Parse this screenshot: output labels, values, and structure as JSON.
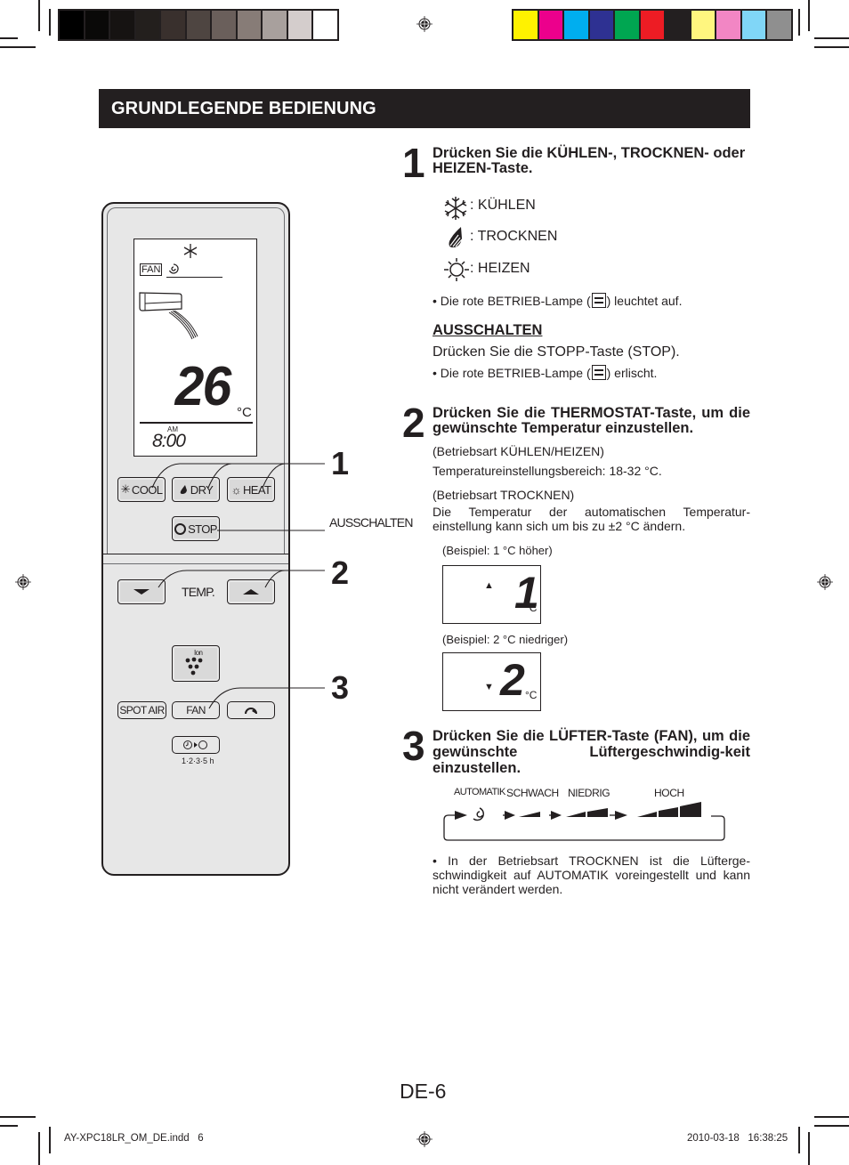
{
  "print_marks": {
    "gray_swatches": [
      "#000000",
      "#0a0908",
      "#161312",
      "#231f1d",
      "#39302d",
      "#4e4541",
      "#6a5f5b",
      "#877c77",
      "#a8a09d",
      "#d4cdcc",
      "#ffffff"
    ],
    "color_swatches": [
      "#fff200",
      "#ec008c",
      "#00aeef",
      "#2e3192",
      "#00a651",
      "#ed1c24",
      "#231f20",
      "#fff67f",
      "#f286c4",
      "#80d6f7",
      "#8f8f8f"
    ]
  },
  "header": {
    "title": "GRUNDLEGENDE BEDIENUNG"
  },
  "step1": {
    "number": "1",
    "title": "Drücken Sie die KÜHLEN-, TROCKNEN- oder HEIZEN-Taste.",
    "modes": [
      {
        "icon": "snowflake-icon",
        "label": ": KÜHLEN"
      },
      {
        "icon": "droplet-icon",
        "label": ": TROCKNEN"
      },
      {
        "icon": "sun-icon",
        "label": ": HEIZEN"
      }
    ],
    "note_before": "• Die rote BETRIEB-Lampe (",
    "note_after": ") leuchtet auf."
  },
  "off": {
    "heading": "AUSSCHALTEN",
    "text": "Drücken Sie die STOPP-Taste (STOP).",
    "note_before": "• Die rote BETRIEB-Lampe (",
    "note_after": ") erlischt."
  },
  "step2": {
    "number": "2",
    "title": "Drücken Sie die THERMOSTAT-Taste, um die gewünschte Temperatur einzustellen.",
    "mode1": "(Betriebsart KÜHLEN/HEIZEN)",
    "range": "Temperatureinstellungsbereich: 18-32 °C.",
    "mode2": "(Betriebsart TROCKNEN)",
    "dry_text": "Die Temperatur der automatischen Temperatur-einstellung kann sich um bis zu ±2 °C ändern.",
    "example1": {
      "caption": "(Beispiel: 1 °C höher)",
      "arrow": "▲",
      "digit": "1",
      "unit": "°C"
    },
    "example2": {
      "caption": "(Beispiel: 2 °C niedriger)",
      "arrow": "▼",
      "digit": "2",
      "unit": "°C"
    }
  },
  "step3": {
    "number": "3",
    "title": "Drücken Sie die LÜFTER-Taste (FAN), um die gewünschte Lüftergeschwindig-keit einzustellen.",
    "speeds": [
      "AUTOMATIK",
      "SCHWACH",
      "NIEDRIG",
      "HOCH"
    ],
    "note": "• In der Betriebsart TROCKNEN ist die Lüfterge-schwindigkeit auf AUTOMATIK voreingestellt und kann nicht verändert werden."
  },
  "remote": {
    "lcd": {
      "fan_label": "FAN",
      "temperature": "26",
      "unit": "°C",
      "am": "AM",
      "time": "8:00"
    },
    "buttons": {
      "cool": "COOL",
      "dry": "DRY",
      "heat": "HEAT",
      "stop": "STOP",
      "temp": "TEMP.",
      "spot_air": "SPOT AIR",
      "fan": "FAN",
      "ion": "Ion",
      "timer_label": "1·2·3·5 h"
    },
    "callouts": {
      "c1": "1",
      "off": "AUSSCHALTEN",
      "c2": "2",
      "c3": "3"
    }
  },
  "footer": {
    "page": "DE-6",
    "file": "AY-XPC18LR_OM_DE.indd   6",
    "timestamp": "2010-03-18   16:38:25"
  }
}
